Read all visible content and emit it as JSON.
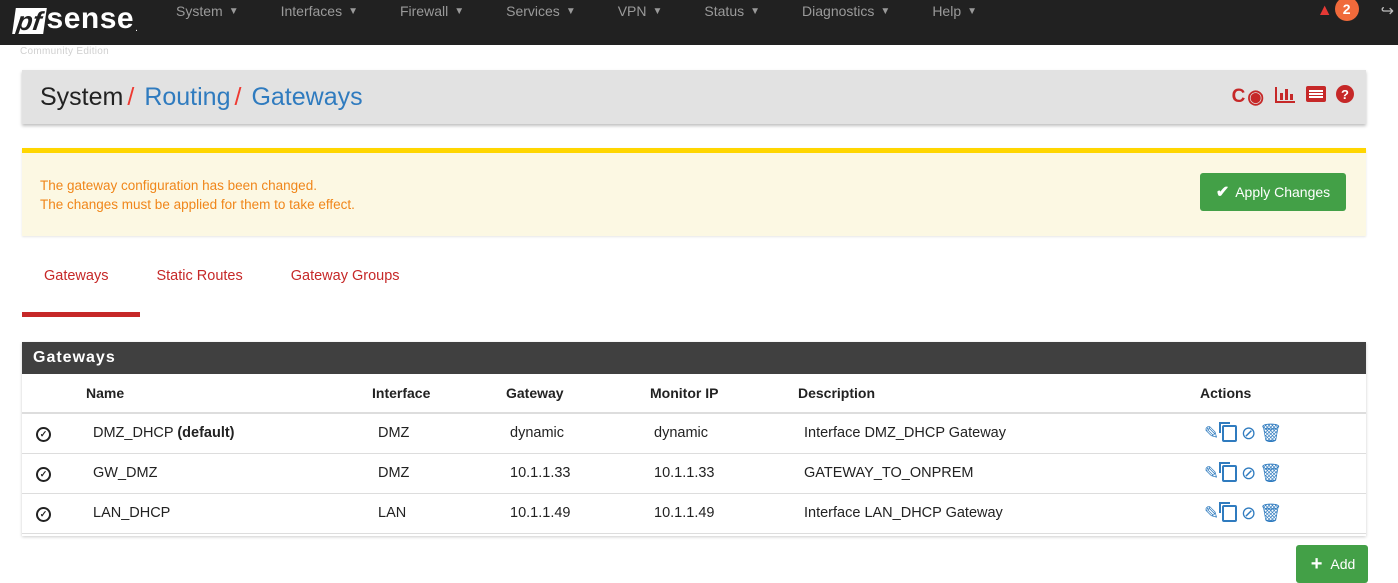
{
  "navbar": {
    "brand_pf": "pf",
    "brand_sense": "sense",
    "brand_sub": "Community Edition",
    "menu": [
      {
        "label": "System"
      },
      {
        "label": "Interfaces"
      },
      {
        "label": "Firewall"
      },
      {
        "label": "Services"
      },
      {
        "label": "VPN"
      },
      {
        "label": "Status"
      },
      {
        "label": "Diagnostics"
      },
      {
        "label": "Help"
      }
    ],
    "notification_count": "2"
  },
  "breadcrumb": {
    "root": "System",
    "sep": "/",
    "level1": "Routing",
    "level2": "Gateways"
  },
  "alert": {
    "line1": "The gateway configuration has been changed.",
    "line2": "The changes must be applied for them to take effect.",
    "apply_label": "Apply Changes"
  },
  "tabs": [
    {
      "label": "Gateways",
      "active": true
    },
    {
      "label": "Static Routes"
    },
    {
      "label": "Gateway Groups"
    }
  ],
  "panel": {
    "title": "Gateways",
    "columns": [
      "Name",
      "Interface",
      "Gateway",
      "Monitor IP",
      "Description",
      "Actions"
    ],
    "rows": [
      {
        "name": "DMZ_DHCP",
        "default_tag": "(default)",
        "interface": "DMZ",
        "gateway": "dynamic",
        "monitor_ip": "dynamic",
        "description": "Interface DMZ_DHCP Gateway"
      },
      {
        "name": "GW_DMZ",
        "default_tag": "",
        "interface": "DMZ",
        "gateway": "10.1.1.33",
        "monitor_ip": "10.1.1.33",
        "description": "GATEWAY_TO_ONPREM"
      },
      {
        "name": "LAN_DHCP",
        "default_tag": "",
        "interface": "LAN",
        "gateway": "10.1.1.49",
        "monitor_ip": "10.1.1.49",
        "description": "Interface LAN_DHCP Gateway"
      }
    ]
  },
  "add_button": {
    "label": "Add"
  },
  "colors": {
    "accent_red": "#c62828",
    "link_blue": "#2f7bbf",
    "success_green": "#43a047",
    "warning_text": "#f0861a"
  }
}
